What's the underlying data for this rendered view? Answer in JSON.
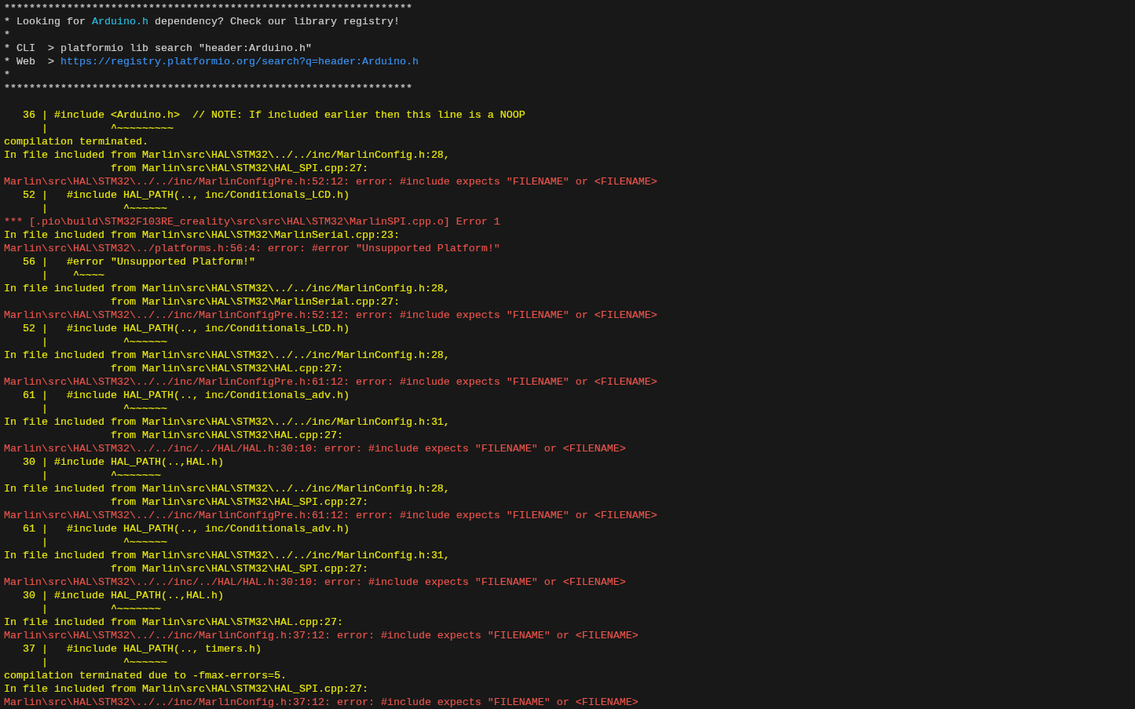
{
  "terminal": {
    "lines": [
      {
        "kind": "text",
        "segments": [
          {
            "kind": "text",
            "text": "*****************************************************************"
          }
        ]
      },
      {
        "kind": "text",
        "segments": [
          {
            "kind": "text",
            "text": "* Looking for "
          },
          {
            "kind": "text",
            "text": "Arduino.h",
            "color": "#29b8db"
          },
          {
            "kind": "text",
            "text": " dependency? Check our library registry!"
          }
        ]
      },
      {
        "kind": "text",
        "segments": [
          {
            "kind": "text",
            "text": "*"
          }
        ]
      },
      {
        "kind": "text",
        "segments": [
          {
            "kind": "text",
            "text": "* CLI  > platformio lib search \"header:Arduino.h\""
          }
        ]
      },
      {
        "kind": "text",
        "segments": [
          {
            "kind": "text",
            "text": "* Web  > "
          },
          {
            "kind": "link",
            "text": "https://registry.platformio.org/search?q=header:Arduino.h",
            "color": "#3b8eea"
          }
        ]
      },
      {
        "kind": "text",
        "segments": [
          {
            "kind": "text",
            "text": "*"
          }
        ]
      },
      {
        "kind": "text",
        "segments": [
          {
            "kind": "text",
            "text": "*****************************************************************"
          }
        ]
      },
      {
        "kind": "blank"
      },
      {
        "kind": "text",
        "segments": [
          {
            "kind": "text",
            "text": "   36 | #include <Arduino.h>  // NOTE: If included earlier then this line is a NOOP",
            "color": "#e5e510"
          }
        ]
      },
      {
        "kind": "text",
        "segments": [
          {
            "kind": "text",
            "text": "      |          ^~~~~~~~~~",
            "color": "#e5e510"
          }
        ]
      },
      {
        "kind": "text",
        "segments": [
          {
            "kind": "text",
            "text": "compilation terminated.",
            "color": "#e5e510"
          }
        ]
      },
      {
        "kind": "text",
        "segments": [
          {
            "kind": "text",
            "text": "In file included from Marlin\\src\\HAL\\STM32\\../../inc/MarlinConfig.h:28,",
            "color": "#e5e510"
          }
        ]
      },
      {
        "kind": "text",
        "segments": [
          {
            "kind": "text",
            "text": "                 from Marlin\\src\\HAL\\STM32\\HAL_SPI.cpp:27:",
            "color": "#e5e510"
          }
        ]
      },
      {
        "kind": "text",
        "segments": [
          {
            "kind": "text",
            "text": "Marlin\\src\\HAL\\STM32\\../../inc/MarlinConfigPre.h:52:12: error: #include expects \"FILENAME\" or <FILENAME>",
            "color": "#e5534b"
          }
        ]
      },
      {
        "kind": "text",
        "segments": [
          {
            "kind": "text",
            "text": "   52 |   #include HAL_PATH(.., inc/Conditionals_LCD.h)",
            "color": "#e5e510"
          }
        ]
      },
      {
        "kind": "text",
        "segments": [
          {
            "kind": "text",
            "text": "      |            ^~~~~~~",
            "color": "#e5e510"
          }
        ]
      },
      {
        "kind": "text",
        "segments": [
          {
            "kind": "text",
            "text": "*** [.pio\\build\\STM32F103RE_creality\\src\\src\\HAL\\STM32\\MarlinSPI.cpp.o] Error 1",
            "color": "#e5534b"
          }
        ]
      },
      {
        "kind": "text",
        "segments": [
          {
            "kind": "text",
            "text": "In file included from Marlin\\src\\HAL\\STM32\\MarlinSerial.cpp:23:",
            "color": "#e5e510"
          }
        ]
      },
      {
        "kind": "text",
        "segments": [
          {
            "kind": "text",
            "text": "Marlin\\src\\HAL\\STM32\\../platforms.h:56:4: error: #error \"Unsupported Platform!\"",
            "color": "#e5534b"
          }
        ]
      },
      {
        "kind": "text",
        "segments": [
          {
            "kind": "text",
            "text": "   56 |   #error \"Unsupported Platform!\"",
            "color": "#e5e510"
          }
        ]
      },
      {
        "kind": "text",
        "segments": [
          {
            "kind": "text",
            "text": "      |    ^~~~~",
            "color": "#e5e510"
          }
        ]
      },
      {
        "kind": "text",
        "segments": [
          {
            "kind": "text",
            "text": "In file included from Marlin\\src\\HAL\\STM32\\../../inc/MarlinConfig.h:28,",
            "color": "#e5e510"
          }
        ]
      },
      {
        "kind": "text",
        "segments": [
          {
            "kind": "text",
            "text": "                 from Marlin\\src\\HAL\\STM32\\MarlinSerial.cpp:27:",
            "color": "#e5e510"
          }
        ]
      },
      {
        "kind": "text",
        "segments": [
          {
            "kind": "text",
            "text": "Marlin\\src\\HAL\\STM32\\../../inc/MarlinConfigPre.h:52:12: error: #include expects \"FILENAME\" or <FILENAME>",
            "color": "#e5534b"
          }
        ]
      },
      {
        "kind": "text",
        "segments": [
          {
            "kind": "text",
            "text": "   52 |   #include HAL_PATH(.., inc/Conditionals_LCD.h)",
            "color": "#e5e510"
          }
        ]
      },
      {
        "kind": "text",
        "segments": [
          {
            "kind": "text",
            "text": "      |            ^~~~~~~",
            "color": "#e5e510"
          }
        ]
      },
      {
        "kind": "text",
        "segments": [
          {
            "kind": "text",
            "text": "In file included from Marlin\\src\\HAL\\STM32\\../../inc/MarlinConfig.h:28,",
            "color": "#e5e510"
          }
        ]
      },
      {
        "kind": "text",
        "segments": [
          {
            "kind": "text",
            "text": "                 from Marlin\\src\\HAL\\STM32\\HAL.cpp:27:",
            "color": "#e5e510"
          }
        ]
      },
      {
        "kind": "text",
        "segments": [
          {
            "kind": "text",
            "text": "Marlin\\src\\HAL\\STM32\\../../inc/MarlinConfigPre.h:61:12: error: #include expects \"FILENAME\" or <FILENAME>",
            "color": "#e5534b"
          }
        ]
      },
      {
        "kind": "text",
        "segments": [
          {
            "kind": "text",
            "text": "   61 |   #include HAL_PATH(.., inc/Conditionals_adv.h)",
            "color": "#e5e510"
          }
        ]
      },
      {
        "kind": "text",
        "segments": [
          {
            "kind": "text",
            "text": "      |            ^~~~~~~",
            "color": "#e5e510"
          }
        ]
      },
      {
        "kind": "text",
        "segments": [
          {
            "kind": "text",
            "text": "In file included from Marlin\\src\\HAL\\STM32\\../../inc/MarlinConfig.h:31,",
            "color": "#e5e510"
          }
        ]
      },
      {
        "kind": "text",
        "segments": [
          {
            "kind": "text",
            "text": "                 from Marlin\\src\\HAL\\STM32\\HAL.cpp:27:",
            "color": "#e5e510"
          }
        ]
      },
      {
        "kind": "text",
        "segments": [
          {
            "kind": "text",
            "text": "Marlin\\src\\HAL\\STM32\\../../inc/../HAL/HAL.h:30:10: error: #include expects \"FILENAME\" or <FILENAME>",
            "color": "#e5534b"
          }
        ]
      },
      {
        "kind": "text",
        "segments": [
          {
            "kind": "text",
            "text": "   30 | #include HAL_PATH(..,HAL.h)",
            "color": "#e5e510"
          }
        ]
      },
      {
        "kind": "text",
        "segments": [
          {
            "kind": "text",
            "text": "      |          ^~~~~~~~",
            "color": "#e5e510"
          }
        ]
      },
      {
        "kind": "text",
        "segments": [
          {
            "kind": "text",
            "text": "In file included from Marlin\\src\\HAL\\STM32\\../../inc/MarlinConfig.h:28,",
            "color": "#e5e510"
          }
        ]
      },
      {
        "kind": "text",
        "segments": [
          {
            "kind": "text",
            "text": "                 from Marlin\\src\\HAL\\STM32\\HAL_SPI.cpp:27:",
            "color": "#e5e510"
          }
        ]
      },
      {
        "kind": "text",
        "segments": [
          {
            "kind": "text",
            "text": "Marlin\\src\\HAL\\STM32\\../../inc/MarlinConfigPre.h:61:12: error: #include expects \"FILENAME\" or <FILENAME>",
            "color": "#e5534b"
          }
        ]
      },
      {
        "kind": "text",
        "segments": [
          {
            "kind": "text",
            "text": "   61 |   #include HAL_PATH(.., inc/Conditionals_adv.h)",
            "color": "#e5e510"
          }
        ]
      },
      {
        "kind": "text",
        "segments": [
          {
            "kind": "text",
            "text": "      |            ^~~~~~~",
            "color": "#e5e510"
          }
        ]
      },
      {
        "kind": "text",
        "segments": [
          {
            "kind": "text",
            "text": "In file included from Marlin\\src\\HAL\\STM32\\../../inc/MarlinConfig.h:31,",
            "color": "#e5e510"
          }
        ]
      },
      {
        "kind": "text",
        "segments": [
          {
            "kind": "text",
            "text": "                 from Marlin\\src\\HAL\\STM32\\HAL_SPI.cpp:27:",
            "color": "#e5e510"
          }
        ]
      },
      {
        "kind": "text",
        "segments": [
          {
            "kind": "text",
            "text": "Marlin\\src\\HAL\\STM32\\../../inc/../HAL/HAL.h:30:10: error: #include expects \"FILENAME\" or <FILENAME>",
            "color": "#e5534b"
          }
        ]
      },
      {
        "kind": "text",
        "segments": [
          {
            "kind": "text",
            "text": "   30 | #include HAL_PATH(..,HAL.h)",
            "color": "#e5e510"
          }
        ]
      },
      {
        "kind": "text",
        "segments": [
          {
            "kind": "text",
            "text": "      |          ^~~~~~~~",
            "color": "#e5e510"
          }
        ]
      },
      {
        "kind": "text",
        "segments": [
          {
            "kind": "text",
            "text": "In file included from Marlin\\src\\HAL\\STM32\\HAL.cpp:27:",
            "color": "#e5e510"
          }
        ]
      },
      {
        "kind": "text",
        "segments": [
          {
            "kind": "text",
            "text": "Marlin\\src\\HAL\\STM32\\../../inc/MarlinConfig.h:37:12: error: #include expects \"FILENAME\" or <FILENAME>",
            "color": "#e5534b"
          }
        ]
      },
      {
        "kind": "text",
        "segments": [
          {
            "kind": "text",
            "text": "   37 |   #include HAL_PATH(.., timers.h)",
            "color": "#e5e510"
          }
        ]
      },
      {
        "kind": "text",
        "segments": [
          {
            "kind": "text",
            "text": "      |            ^~~~~~~",
            "color": "#e5e510"
          }
        ]
      },
      {
        "kind": "text",
        "segments": [
          {
            "kind": "text",
            "text": "compilation terminated due to -fmax-errors=5.",
            "color": "#e5e510"
          }
        ]
      },
      {
        "kind": "text",
        "segments": [
          {
            "kind": "text",
            "text": "In file included from Marlin\\src\\HAL\\STM32\\HAL_SPI.cpp:27:",
            "color": "#e5e510"
          }
        ]
      },
      {
        "kind": "text",
        "segments": [
          {
            "kind": "text",
            "text": "Marlin\\src\\HAL\\STM32\\../../inc/MarlinConfig.h:37:12: error: #include expects \"FILENAME\" or <FILENAME>",
            "color": "#e5534b"
          }
        ]
      }
    ]
  }
}
